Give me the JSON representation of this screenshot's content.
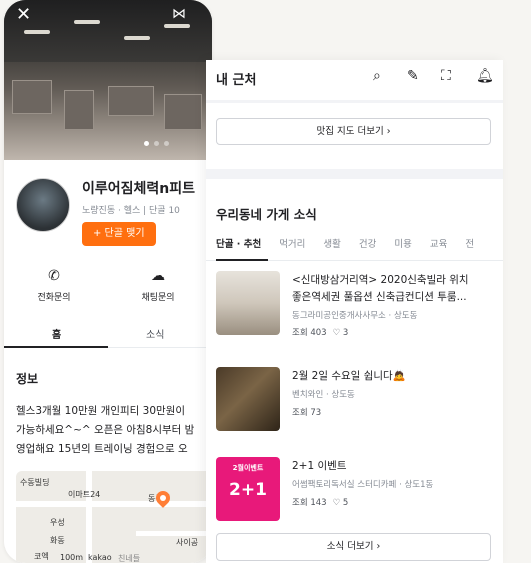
{
  "gym": {
    "close_icon": "close-icon",
    "share_icon": "share-icon",
    "name": "이루어짐체력n피트",
    "meta": "노량진동 · 헬스  |  단골 10",
    "follow_label": "+ 단골 맺기",
    "actions": [
      {
        "icon": "phone-icon",
        "label": "전화문의"
      },
      {
        "icon": "chat-icon",
        "label": "채팅문의"
      }
    ],
    "tabs": [
      "홈",
      "소식"
    ],
    "info_title": "정보",
    "info_lines": [
      "헬스3개월 10만원 개인피티 30만원이",
      "가능하세요^~^ 오픈은 아침8시부터 밤",
      "영업해요 15년의 트레이닝 경험으로 오"
    ],
    "map_labels": [
      "수동빌딩",
      "이마트24",
      "동구청",
      "우성",
      "화동",
      "사이공",
      "코엑",
      "100m",
      "kakao",
      "친네들"
    ]
  },
  "local": {
    "title": "내 근처",
    "header_icons": [
      "search-icon",
      "edit-icon",
      "scan-icon",
      "bell-icon"
    ],
    "map_more": "맛집 지도 더보기  ›",
    "section_title": "우리동네 가게 소식",
    "categories": [
      "단골 · 추천",
      "먹거리",
      "생활",
      "건강",
      "미용",
      "교육",
      "전"
    ],
    "items": [
      {
        "title_line1": "<신대방삼거리역> 2020신축빌라 위치",
        "title_line2": "좋은역세권 풀옵션 신축급컨디션 투룸...",
        "sub": "동그라미공인중개사사무소 · 상도동",
        "views": "조회 403",
        "likes": "♡ 3"
      },
      {
        "title_line1": "2월 2일 수요일 쉽니다🙇",
        "title_line2": "",
        "sub": "벤치와인 · 상도동",
        "views": "조회 73",
        "likes": ""
      },
      {
        "title_line1": "2+1 이벤트",
        "title_line2": "",
        "sub": "어썸팩토리독서실 스터디카페 · 상도1동",
        "views": "조회 143",
        "likes": "♡ 5"
      }
    ],
    "thumb3_text": [
      "2월이벤트",
      "2+1"
    ],
    "more_news": "소식 더보기  ›"
  },
  "colors": {
    "accent": "#ff6f0f",
    "thumb3": "#e8197a"
  }
}
